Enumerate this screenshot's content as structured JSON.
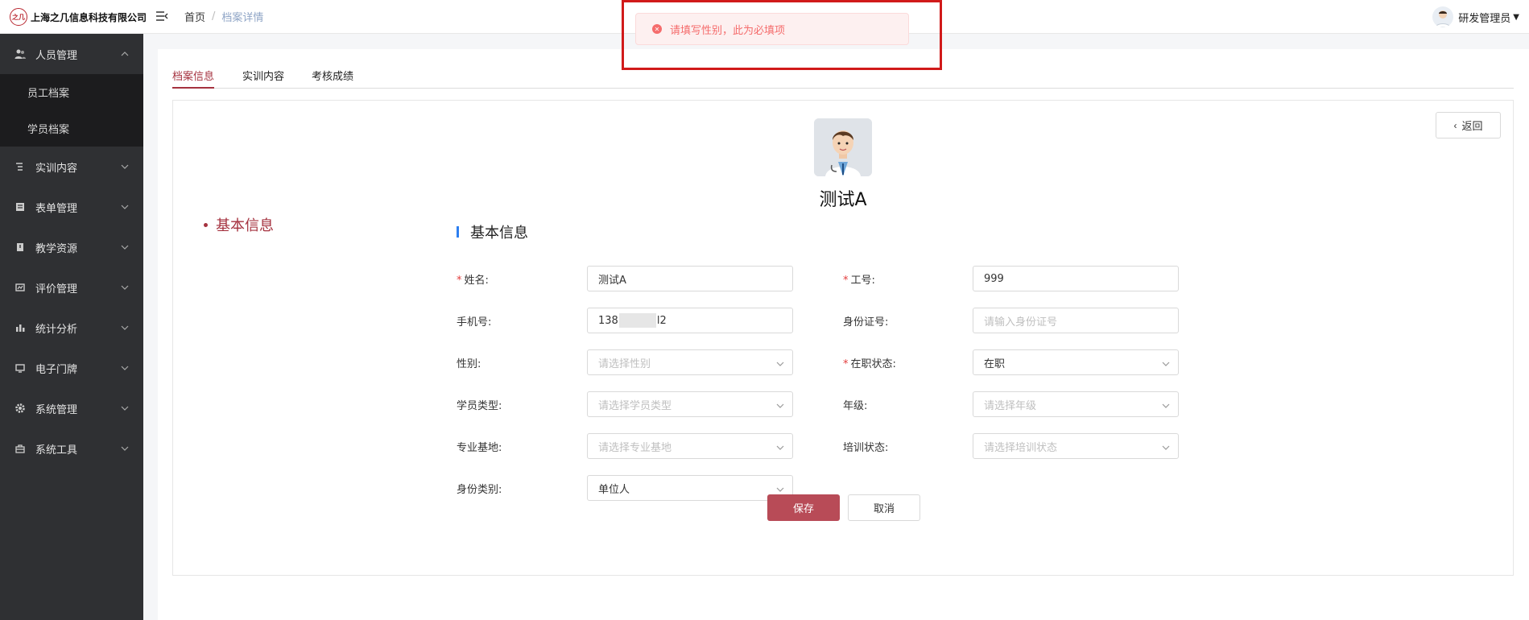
{
  "brand": {
    "logo_text": "之几",
    "name": "上海之几信息科技有限公司"
  },
  "breadcrumb": {
    "home": "首页",
    "separator": "/",
    "current": "档案详情"
  },
  "user": {
    "name": "研发管理员"
  },
  "sidebar": {
    "groups": [
      {
        "label": "人员管理",
        "icon": "users-icon",
        "expanded": true,
        "children": [
          {
            "label": "员工档案"
          },
          {
            "label": "学员档案"
          }
        ]
      },
      {
        "label": "实训内容",
        "icon": "list-icon"
      },
      {
        "label": "表单管理",
        "icon": "form-icon"
      },
      {
        "label": "教学资源",
        "icon": "book-icon"
      },
      {
        "label": "评价管理",
        "icon": "rating-icon"
      },
      {
        "label": "统计分析",
        "icon": "bar-chart-icon"
      },
      {
        "label": "电子门牌",
        "icon": "monitor-icon"
      },
      {
        "label": "系统管理",
        "icon": "gear-icon"
      },
      {
        "label": "系统工具",
        "icon": "toolbox-icon"
      }
    ]
  },
  "tabs": [
    {
      "label": "档案信息",
      "active": true
    },
    {
      "label": "实训内容"
    },
    {
      "label": "考核成绩"
    }
  ],
  "profile": {
    "name": "测试A",
    "back_label": "返回"
  },
  "anchor": {
    "label": "基本信息"
  },
  "section": {
    "title": "基本信息"
  },
  "form": {
    "name": {
      "label": "姓名:",
      "required": true,
      "value": "测试A"
    },
    "job_no": {
      "label": "工号:",
      "required": true,
      "value": "999"
    },
    "phone": {
      "label": "手机号:",
      "value_prefix": "138",
      "value_suffix": "l2"
    },
    "id_card": {
      "label": "身份证号:",
      "placeholder": "请输入身份证号"
    },
    "gender": {
      "label": "性别:",
      "placeholder": "请选择性别"
    },
    "employment": {
      "label": "在职状态:",
      "required": true,
      "value": "在职"
    },
    "student_type": {
      "label": "学员类型:",
      "placeholder": "请选择学员类型"
    },
    "grade": {
      "label": "年级:",
      "placeholder": "请选择年级"
    },
    "base": {
      "label": "专业基地:",
      "placeholder": "请选择专业基地"
    },
    "training": {
      "label": "培训状态:",
      "placeholder": "请选择培训状态"
    },
    "identity": {
      "label": "身份类别:",
      "value": "单位人"
    }
  },
  "actions": {
    "save": "保存",
    "cancel": "取消"
  },
  "toast": {
    "message": "请填写性别，此为必填项",
    "type": "error",
    "color": "#f56c6c"
  },
  "colors": {
    "accent": "#a5323f",
    "primary_button": "#b84b57",
    "sidebar_bg": "#2f3033",
    "section_bar": "#2d7ff0"
  }
}
